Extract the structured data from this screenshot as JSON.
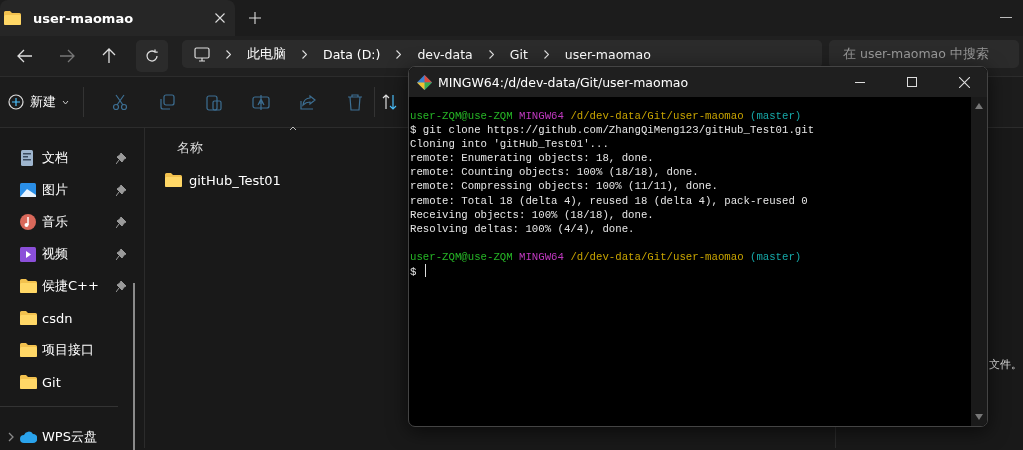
{
  "explorer": {
    "tab": {
      "title": "user-maomao",
      "selected": true
    },
    "breadcrumb": [
      "此电脑",
      "Data (D:)",
      "dev-data",
      "Git",
      "user-maomao"
    ],
    "search": {
      "placeholder": "在 user-maomao 中搜索"
    },
    "new_button": "新建",
    "sidebar": [
      {
        "label": "文档",
        "kind": "document",
        "pinned": true,
        "expandable": false,
        "separated": false
      },
      {
        "label": "图片",
        "kind": "pictures",
        "pinned": true,
        "expandable": false,
        "separated": false
      },
      {
        "label": "音乐",
        "kind": "music",
        "pinned": true,
        "expandable": false,
        "separated": false
      },
      {
        "label": "视频",
        "kind": "video",
        "pinned": true,
        "expandable": false,
        "separated": false
      },
      {
        "label": "侯捷C++",
        "kind": "folder",
        "pinned": true,
        "expandable": false,
        "separated": false
      },
      {
        "label": "csdn",
        "kind": "folder",
        "pinned": false,
        "expandable": false,
        "separated": false
      },
      {
        "label": "项目接口",
        "kind": "folder",
        "pinned": false,
        "expandable": false,
        "separated": false
      },
      {
        "label": "Git",
        "kind": "folder",
        "pinned": false,
        "expandable": false,
        "separated": false
      },
      {
        "label": "WPS云盘",
        "kind": "cloud",
        "pinned": false,
        "expandable": true,
        "separated": true
      }
    ],
    "file_list": {
      "column": "名称",
      "rows": [
        {
          "name": "gitHub_Test01",
          "kind": "folder"
        }
      ]
    },
    "details_text": "文件。"
  },
  "terminal": {
    "title": "MINGW64:/d/dev-data/Git/user-maomao",
    "lines": [
      {
        "kind": "prompt",
        "user": "user-ZQM@use-ZQM",
        "system": "MINGW64",
        "path": "/d/dev-data/Git/user-maomao",
        "branch": "(master)"
      },
      {
        "kind": "command",
        "prompt": "$",
        "text": "git clone https://github.com/ZhangQiMeng123/gitHub_Test01.git",
        "cursor": false
      },
      {
        "kind": "output",
        "text": "Cloning into 'gitHub_Test01'..."
      },
      {
        "kind": "output",
        "text": "remote: Enumerating objects: 18, done."
      },
      {
        "kind": "output",
        "text": "remote: Counting objects: 100% (18/18), done."
      },
      {
        "kind": "output",
        "text": "remote: Compressing objects: 100% (11/11), done."
      },
      {
        "kind": "output",
        "text": "remote: Total 18 (delta 4), reused 18 (delta 4), pack-reused 0"
      },
      {
        "kind": "output",
        "text": "Receiving objects: 100% (18/18), done."
      },
      {
        "kind": "output",
        "text": "Resolving deltas: 100% (4/4), done."
      },
      {
        "kind": "blank"
      },
      {
        "kind": "prompt",
        "user": "user-ZQM@use-ZQM",
        "system": "MINGW64",
        "path": "/d/dev-data/Git/user-maomao",
        "branch": "(master)"
      },
      {
        "kind": "command",
        "prompt": "$",
        "cursor": true
      }
    ]
  }
}
